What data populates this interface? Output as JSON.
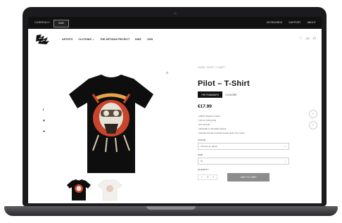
{
  "topbar": {
    "currency_label": "CURRENCY",
    "currency_value": "EUR",
    "links": [
      "KEYBOARDS",
      "SUPPORT",
      "ABOUT"
    ]
  },
  "nav": {
    "menu": [
      "ARTISTS",
      "CLOTHING ⌄",
      "THE ARTISAN PROJECT",
      "BIKE",
      "JOIN"
    ],
    "icons": [
      "heart-icon",
      "cart-icon",
      "user-icon"
    ],
    "cart_count": "0"
  },
  "product": {
    "breadcrumb": "HOME / SHOP / T-SHIRT",
    "title": "Pilot – T-Shirt",
    "tag_primary": "THE RUNAWAYS",
    "tag_secondary": "2 COLORS",
    "price": "€17.99",
    "features": [
      "• 100% ringspun cotton",
      "• 4.8 oz (145 g/m2)",
      "• Pre-shrunk",
      "• Shoulder-to-shoulder taping",
      "• Quarter-turned to avoid crease down the center"
    ],
    "color_label": "COLOR",
    "color_value": "Choose an option",
    "size_label": "SIZE",
    "size_value": "M",
    "qty_label": "QUANTITY",
    "qty_value": "1",
    "add_to_cart": "ADD TO CART"
  },
  "colors": {
    "shirt": "#0e0e0f",
    "accent": "#c8442a",
    "topbar": "#111111"
  }
}
